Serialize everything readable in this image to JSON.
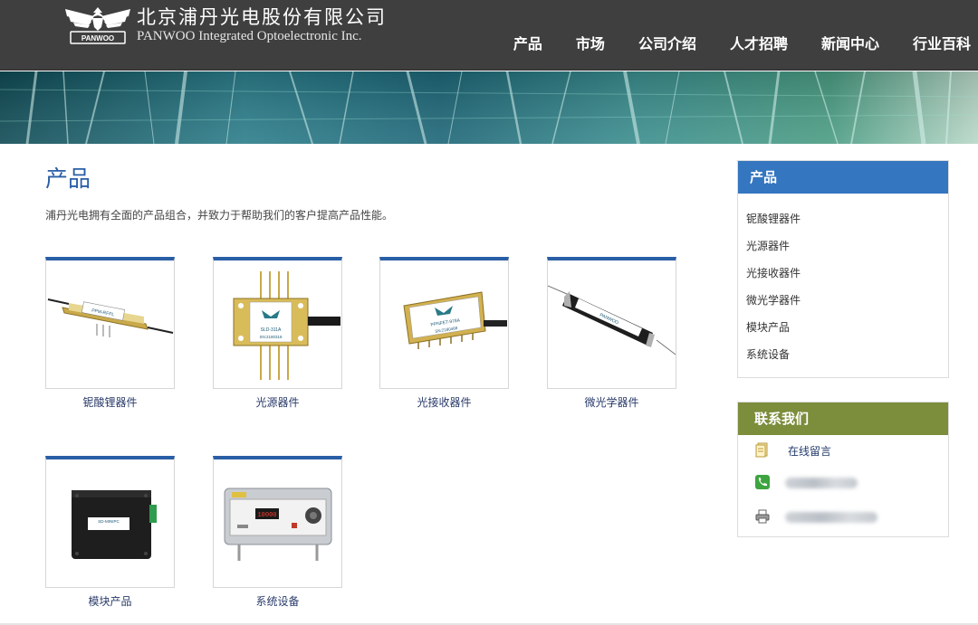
{
  "brand": {
    "name_cn": "北京浦丹光电股份有限公司",
    "name_en": "PANWOO Integrated Optoelectronic Inc.",
    "logo_text": "PANWOO"
  },
  "nav": {
    "items": [
      {
        "label": "产品"
      },
      {
        "label": "市场"
      },
      {
        "label": "公司介绍"
      },
      {
        "label": "人才招聘"
      },
      {
        "label": "新闻中心"
      },
      {
        "label": "行业百科"
      }
    ]
  },
  "main": {
    "title": "产品",
    "intro": "浦丹光电拥有全面的产品组合，并致力于帮助我们的客户提高产品性能。",
    "products": [
      {
        "label": "铌酸锂器件",
        "device_text": "PPM-RFPL"
      },
      {
        "label": "光源器件",
        "device_text": "SLD-311A",
        "serial": "SN:2180318"
      },
      {
        "label": "光接收器件",
        "device_text": "PPNFET-978A",
        "serial": "SN:2180468"
      },
      {
        "label": "微光学器件",
        "device_text": "PANWOO"
      },
      {
        "label": "模块产品",
        "device_text": "SD-MINIPC"
      },
      {
        "label": "系统设备",
        "device_text": "10000"
      }
    ]
  },
  "sidebar": {
    "products_title": "产品",
    "products_items": [
      {
        "label": "铌酸锂器件"
      },
      {
        "label": "光源器件"
      },
      {
        "label": "光接收器件"
      },
      {
        "label": "微光学器件"
      },
      {
        "label": "模块产品"
      },
      {
        "label": "系统设备"
      }
    ],
    "contact_title": "联系我们",
    "contact_items": [
      {
        "label": "在线留言",
        "icon": "document-icon"
      },
      {
        "label": "",
        "icon": "phone-icon"
      },
      {
        "label": "",
        "icon": "printer-icon"
      }
    ]
  },
  "colors": {
    "header_bg": "#3f3f3f",
    "accent_blue": "#2a5ea6",
    "sidebar_blue": "#3476c0",
    "sidebar_green": "#7c8d3c"
  }
}
